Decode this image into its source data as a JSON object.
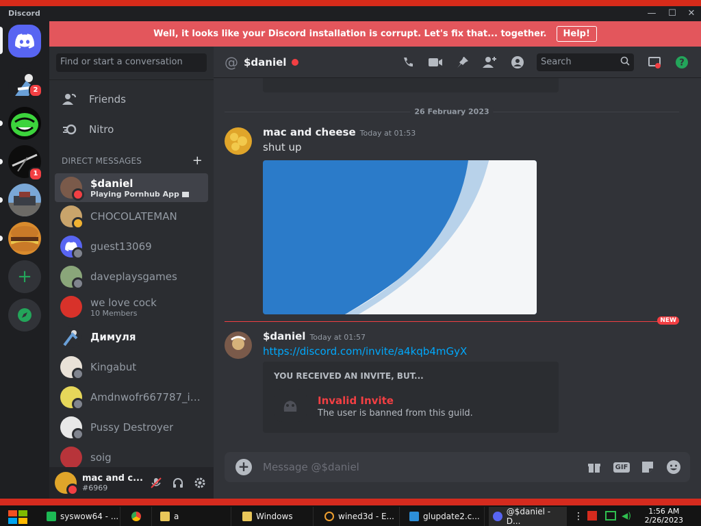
{
  "window": {
    "brand": "Discord",
    "min": "—",
    "max": "☐",
    "close": "✕"
  },
  "banner": {
    "text": "Well, it looks like your Discord installation is corrupt. Let's fix that... together.",
    "button": "Help!"
  },
  "guilds": {
    "badges": {
      "g1": "2",
      "g3": "1"
    }
  },
  "dm_sidebar": {
    "search_placeholder": "Find or start a conversation",
    "nav": [
      {
        "label": "Friends"
      },
      {
        "label": "Nitro"
      }
    ],
    "section_title": "DIRECT MESSAGES",
    "section_plus": "+",
    "items": [
      {
        "name": "$daniel",
        "sub": "Playing Pornhub App"
      },
      {
        "name": "CHOCOLATEMAN"
      },
      {
        "name": "guest13069"
      },
      {
        "name": "daveplaysgames"
      },
      {
        "name": "we love cock",
        "sub": "10 Members"
      },
      {
        "name": "Димуля"
      },
      {
        "name": "Kingabut"
      },
      {
        "name": "Amdnwofr667787_im..."
      },
      {
        "name": "Pussy Destroyer"
      },
      {
        "name": "soig"
      }
    ]
  },
  "user_panel": {
    "name": "mac and c...",
    "tag": "#6969"
  },
  "header": {
    "at": "@",
    "title": "$daniel",
    "search_placeholder": "Search"
  },
  "messages": {
    "date_separator": "26 February 2023",
    "m1": {
      "author": "mac and cheese",
      "timestamp": "Today at 01:53",
      "text": "shut up"
    },
    "new_pill": "NEW",
    "m2": {
      "author": "$daniel",
      "timestamp": "Today at 01:57",
      "link": "https://discord.com/invite/a4kqb4mGyX"
    },
    "invite": {
      "header": "YOU RECEIVED AN INVITE, BUT...",
      "title": "Invalid Invite",
      "desc": "The user is banned from this guild."
    }
  },
  "composer": {
    "placeholder": "Message @$daniel",
    "gif": "GIF"
  },
  "taskbar": {
    "items": [
      {
        "label": "syswow64 - ..."
      },
      {
        "label": ""
      },
      {
        "label": "a"
      },
      {
        "label": "Windows"
      },
      {
        "label": "wined3d - E..."
      },
      {
        "label": "glupdate2.c..."
      },
      {
        "label": "@$daniel - D..."
      }
    ],
    "time": "1:56 AM",
    "date": "2/26/2023"
  },
  "colors": {
    "blurple": "#5865f2",
    "danger": "#f23f43",
    "link": "#00a8fc",
    "green": "#23a55a"
  }
}
